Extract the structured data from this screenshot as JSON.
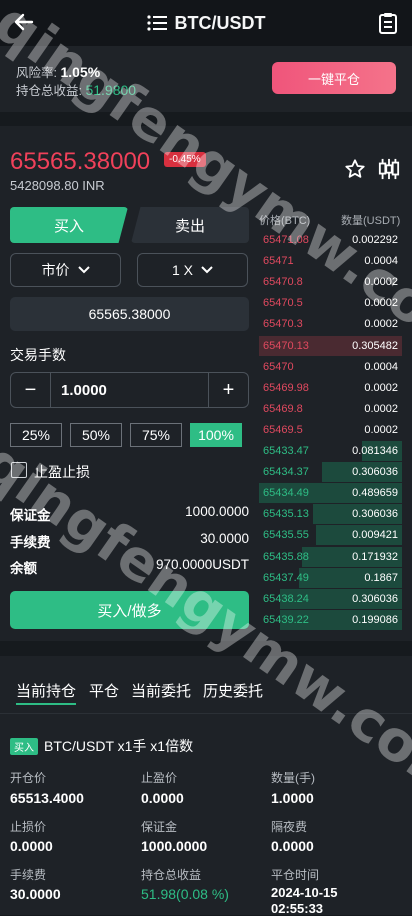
{
  "header": {
    "title": "BTC/USDT"
  },
  "risk": {
    "risk_label": "风险率:",
    "risk_value": "1.05%",
    "pnl_label": "持仓总收益:",
    "pnl_value": "51.9800",
    "close_all_label": "一键平仓"
  },
  "ticker": {
    "price": "65565.38000",
    "change": "-0.45%",
    "inr": "5428098.80 INR"
  },
  "trade": {
    "buy_tab": "买入",
    "sell_tab": "卖出",
    "order_type": "市价",
    "leverage": "1 X",
    "price_value": "65565.38000",
    "qty_label": "交易手数",
    "qty_value": "1.0000",
    "minus": "−",
    "plus": "+",
    "percents": [
      "25%",
      "50%",
      "75%",
      "100%"
    ],
    "tpsl_label": "止盈止损",
    "margin_label": "保证金",
    "margin_value": "1000.0000",
    "fee_label": "手续费",
    "fee_value": "30.0000",
    "balance_label": "余额",
    "balance_value": "970.0000USDT",
    "submit_label": "买入/做多"
  },
  "orderbook": {
    "price_header": "价格(BTC)",
    "qty_header": "数量(USDT)",
    "asks": [
      {
        "price": "65471.08",
        "qty": "0.002292",
        "depth": 0
      },
      {
        "price": "65471",
        "qty": "0.0004",
        "depth": 0
      },
      {
        "price": "65470.8",
        "qty": "0.0002",
        "depth": 0
      },
      {
        "price": "65470.5",
        "qty": "0.0002",
        "depth": 0
      },
      {
        "price": "65470.3",
        "qty": "0.0002",
        "depth": 0
      },
      {
        "price": "65470.13",
        "qty": "0.305482",
        "depth": 1.0
      },
      {
        "price": "65470",
        "qty": "0.0004",
        "depth": 0
      },
      {
        "price": "65469.98",
        "qty": "0.0002",
        "depth": 0
      },
      {
        "price": "65469.8",
        "qty": "0.0002",
        "depth": 0
      },
      {
        "price": "65469.5",
        "qty": "0.0002",
        "depth": 0
      }
    ],
    "bids": [
      {
        "price": "65433.47",
        "qty": "0.081346",
        "depth": 0.28
      },
      {
        "price": "65434.37",
        "qty": "0.306036",
        "depth": 0.56
      },
      {
        "price": "65434.49",
        "qty": "0.489659",
        "depth": 1.0
      },
      {
        "price": "65435.13",
        "qty": "0.306036",
        "depth": 0.62
      },
      {
        "price": "65435.55",
        "qty": "0.009421",
        "depth": 0.6
      },
      {
        "price": "65435.88",
        "qty": "0.171932",
        "depth": 0.7
      },
      {
        "price": "65437.49",
        "qty": "0.1867",
        "depth": 0.72
      },
      {
        "price": "65438.24",
        "qty": "0.306036",
        "depth": 0.85
      },
      {
        "price": "65439.22",
        "qty": "0.199086",
        "depth": 0.85
      }
    ]
  },
  "positions": {
    "tabs": [
      "当前持仓",
      "平仓",
      "当前委托",
      "历史委托"
    ],
    "badge": "买入",
    "title": "BTC/USDT x1手 x1倍数",
    "open_price_label": "开仓价",
    "open_price": "65513.4000",
    "tp_label": "止盈价",
    "tp": "0.0000",
    "qty_label": "数量(手)",
    "qty": "1.0000",
    "sl_label": "止损价",
    "sl": "0.0000",
    "margin_label": "保证金",
    "margin": "1000.0000",
    "overnight_label": "隔夜费",
    "overnight": "0.0000",
    "fee_label": "手续费",
    "fee": "30.0000",
    "pnl_label": "持仓总收益",
    "pnl": "51.98(0.08 %)",
    "close_time_label": "平仓时间",
    "close_date": "2024-10-15",
    "close_time": "02:55:33"
  },
  "watermark": "qingfengymw.com",
  "colors": {
    "buy": "#2ebd85",
    "sell": "#f0415a"
  }
}
